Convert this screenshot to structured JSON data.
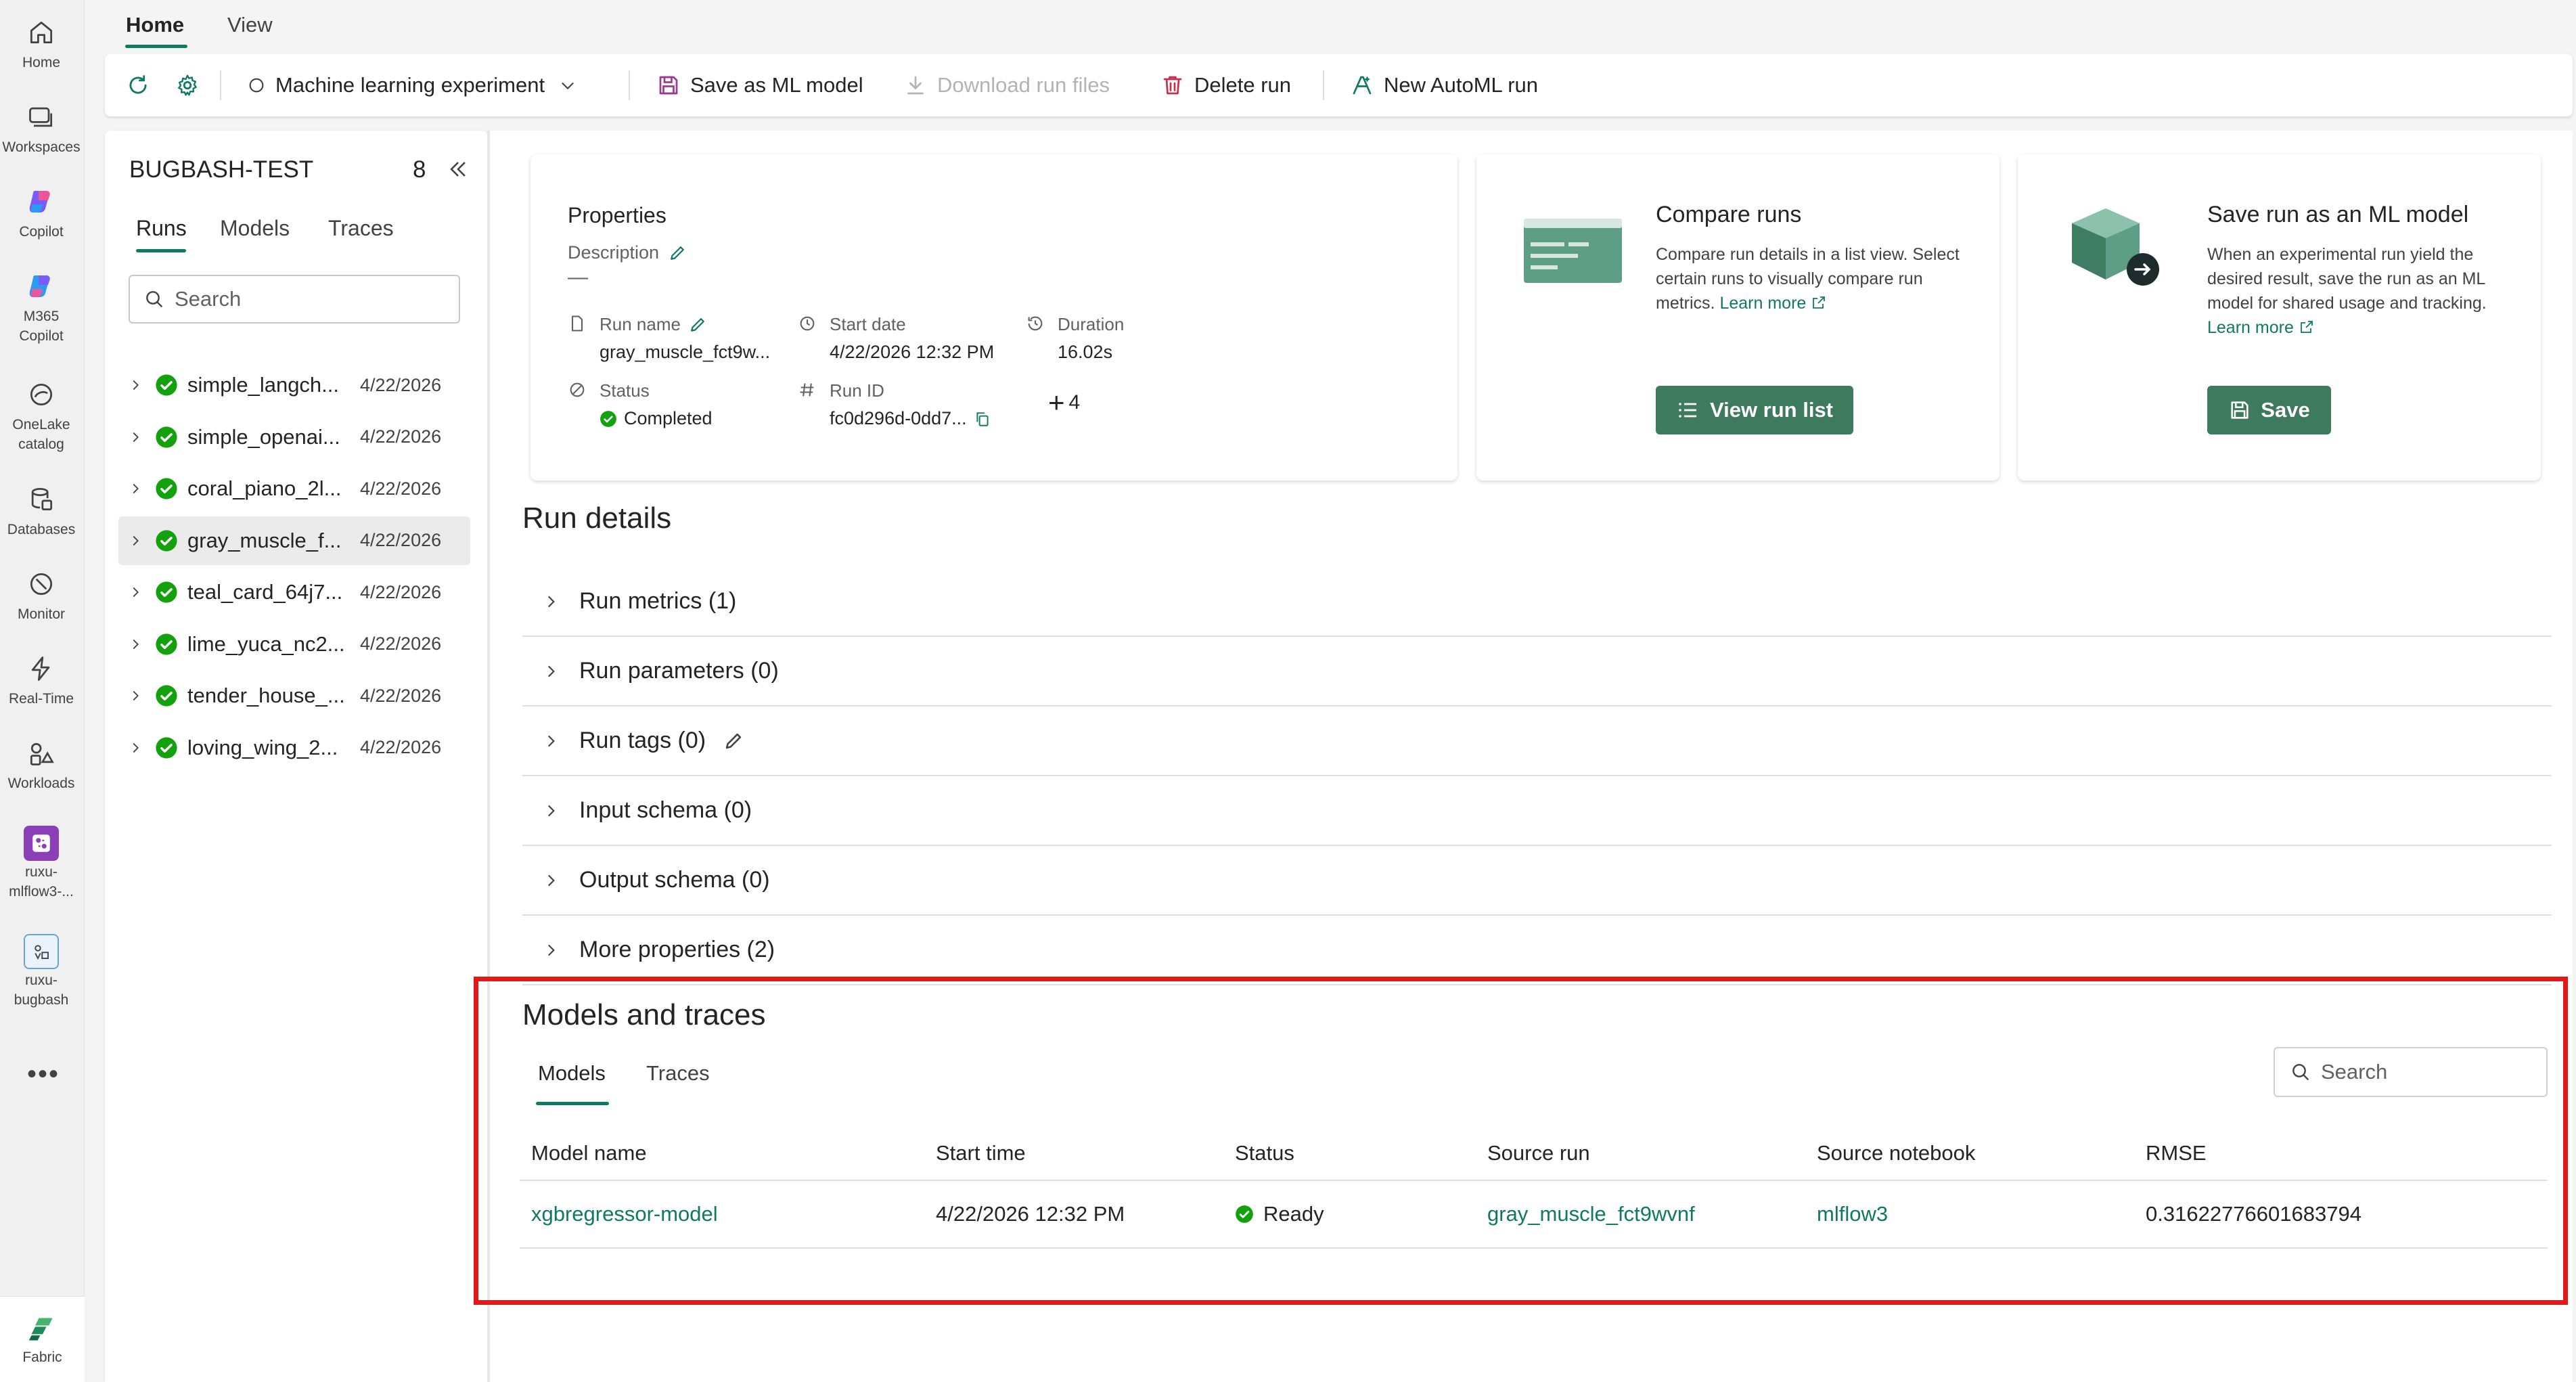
{
  "nav_rail": {
    "items": [
      {
        "label": "Home",
        "icon": "home-icon"
      },
      {
        "label": "Workspaces",
        "icon": "workspaces-icon"
      },
      {
        "label": "Copilot",
        "icon": "copilot-icon"
      },
      {
        "label": "M365 Copilot",
        "icon": "m365-copilot-icon"
      },
      {
        "label": "OneLake catalog",
        "icon": "onelake-catalog-icon"
      },
      {
        "label": "Databases",
        "icon": "databases-icon"
      },
      {
        "label": "Monitor",
        "icon": "monitor-icon"
      },
      {
        "label": "Real-Time",
        "icon": "real-time-icon"
      },
      {
        "label": "Workloads",
        "icon": "workloads-icon"
      },
      {
        "label": "ruxu-mlflow3-...",
        "icon": "experiment-icon"
      },
      {
        "label": "ruxu-bugbash",
        "icon": "workspace-item-icon"
      }
    ],
    "more": "•••",
    "footer_label": "Fabric"
  },
  "top_tabs": [
    "Home",
    "View"
  ],
  "toolbar": {
    "experiment_type": "Machine learning experiment",
    "save_as_ml_model": "Save as ML model",
    "download_run_files": "Download run files",
    "delete_run": "Delete run",
    "new_automl_run": "New AutoML run"
  },
  "runs_panel": {
    "title": "BUGBASH-TEST",
    "count": "8",
    "tabs": [
      "Runs",
      "Models",
      "Traces"
    ],
    "search_placeholder": "Search",
    "runs": [
      {
        "name": "simple_langch...",
        "date": "4/22/2026",
        "selected": false
      },
      {
        "name": "simple_openai...",
        "date": "4/22/2026",
        "selected": false
      },
      {
        "name": "coral_piano_2l...",
        "date": "4/22/2026",
        "selected": false
      },
      {
        "name": "gray_muscle_f...",
        "date": "4/22/2026",
        "selected": true
      },
      {
        "name": "teal_card_64j7...",
        "date": "4/22/2026",
        "selected": false
      },
      {
        "name": "lime_yuca_nc2...",
        "date": "4/22/2026",
        "selected": false
      },
      {
        "name": "tender_house_...",
        "date": "4/22/2026",
        "selected": false
      },
      {
        "name": "loving_wing_2...",
        "date": "4/22/2026",
        "selected": false
      }
    ]
  },
  "properties": {
    "title": "Properties",
    "description_label": "Description",
    "description_value": "—",
    "run_name_label": "Run name",
    "run_name_value": "gray_muscle_fct9w...",
    "start_date_label": "Start date",
    "start_date_value": "4/22/2026 12:32 PM",
    "duration_label": "Duration",
    "duration_value": "16.02s",
    "status_label": "Status",
    "status_value": "Completed",
    "run_id_label": "Run ID",
    "run_id_value": "fc0d296d-0dd7...",
    "more_count": "4"
  },
  "compare_card": {
    "title": "Compare runs",
    "text": "Compare run details in a list view. Select certain runs to visually compare run metrics.",
    "link": "Learn more",
    "button": "View run list"
  },
  "save_card": {
    "title": "Save run as an ML model",
    "text": "When an experimental run yield the desired result, save the run as an ML model for shared usage and tracking.",
    "link": "Learn more",
    "button": "Save"
  },
  "run_details": {
    "title": "Run details",
    "sections": [
      "Run metrics (1)",
      "Run parameters (0)",
      "Run tags (0)",
      "Input schema (0)",
      "Output schema (0)",
      "More properties (2)"
    ]
  },
  "models_traces": {
    "title": "Models and traces",
    "tabs": [
      "Models",
      "Traces"
    ],
    "search_placeholder": "Search",
    "columns": [
      "Model name",
      "Start time",
      "Status",
      "Source run",
      "Source notebook",
      "RMSE"
    ],
    "rows": [
      {
        "model_name": "xgbregressor-model",
        "start_time": "4/22/2026 12:32 PM",
        "status": "Ready",
        "source_run": "gray_muscle_fct9wvnf",
        "source_notebook": "mlflow3",
        "rmse": "0.31622776601683794"
      }
    ]
  },
  "colors": {
    "accent": "#117865",
    "success": "#13a10e",
    "button": "#3d7a5e",
    "highlight": "#e31919"
  }
}
